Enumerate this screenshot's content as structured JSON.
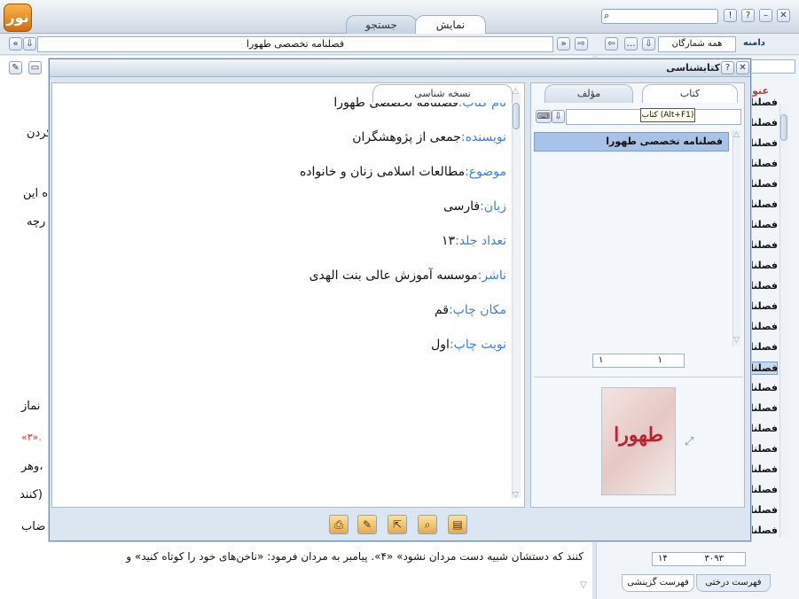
{
  "app": {
    "logo_text": "نور",
    "tabs": {
      "display": "نمایش",
      "search": "جستجو"
    },
    "address": "فصلنامه تخصصی طهورا",
    "scope_label": "دامنه",
    "scope_value": "همه شمارگان"
  },
  "background": {
    "lines": [
      "کردن",
      "ه این",
      "رچه",
      "نماز",
      "«۳».",
      "وهر،",
      "کنند)",
      "ضاب"
    ],
    "bottom_line": "کنند که دستشان شبیه دست مردان نشود» «۴». پیامبر به مردان فرمود: «ناخن‌های خود را کوتاه کنید» و",
    "right_header": "عنو",
    "right_items": [
      "فصلنا",
      "فصلنا",
      "فصلنا",
      "فصلنا",
      "فصلنا",
      "فصلنا",
      "فصلنا",
      "فصلنا",
      "فصلنا",
      "فصلنا",
      "فصلنا",
      "فصلنا",
      "فصلنا",
      "فصلنا",
      "فصلنا",
      "فصلنا",
      "فصلنا",
      "فصلنا",
      "فصلنا",
      "فصلنا",
      "فصلنا",
      "فصلنا"
    ],
    "page_current": "۱۴",
    "page_total": "۳۰۹۳",
    "bottom_tabs": {
      "tree": "فهرست درختی",
      "selective": "فهرست گزینشی"
    }
  },
  "dialog": {
    "title": "کتابشناسی",
    "tab_nuskha": "نسخه شناسی",
    "tab_author": "مؤلف",
    "tab_book": "کتاب",
    "tooltip": "کتاب (Alt+F1)",
    "selected_book": "فصلنامه تخصصی طهورا",
    "pager_left": "۱",
    "pager_right": "۱",
    "meta": [
      {
        "label": "نام کتاب:",
        "value": "فصلنامه تخصصی طهورا"
      },
      {
        "label": "نویسنده:",
        "value": "جمعی از پژوهشگران"
      },
      {
        "label": "موضوع:",
        "value": "مطالعات اسلامی زنان و خانواده"
      },
      {
        "label": "زبان:",
        "value": "فارسی"
      },
      {
        "label": "تعداد جلد:",
        "value": "۱۳"
      },
      {
        "label": "ناشر:",
        "value": "موسسه آموزش عالی بنت الهدی"
      },
      {
        "label": "مکان چاپ:",
        "value": "قم"
      },
      {
        "label": "نوبت چاپ:",
        "value": "اول"
      }
    ],
    "cover_title": "طهورا"
  }
}
